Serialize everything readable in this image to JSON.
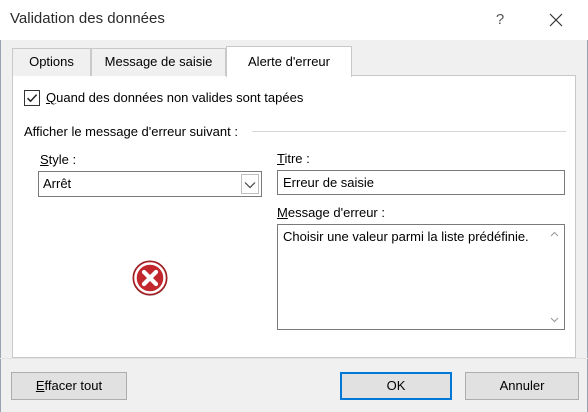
{
  "window": {
    "title": "Validation des données",
    "help_label": "?"
  },
  "tabs": [
    {
      "label": "Options",
      "active": false
    },
    {
      "label": "Message de saisie",
      "active": false
    },
    {
      "label": "Alerte d'erreur",
      "active": true
    }
  ],
  "error_alert": {
    "show_checkbox": {
      "checked": true,
      "label_first": "Q",
      "label_rest": "uand des données non valides sont tapées"
    },
    "section_label": "Afficher le message d'erreur suivant :",
    "style_label": {
      "first": "S",
      "mid": "tyle",
      "end": " :"
    },
    "style_value": "Arrêt",
    "title_label": {
      "first": "T",
      "rest": "itre :"
    },
    "title_value": "Erreur de saisie",
    "message_label": {
      "first": "M",
      "rest": "essage d'erreur :"
    },
    "message_value": "Choisir une valeur parmi la liste prédéfinie.",
    "style_icon": "stop-error-icon"
  },
  "buttons": {
    "clear": {
      "first": "E",
      "rest": "ffacer tout"
    },
    "ok": "OK",
    "cancel": "Annuler"
  },
  "colors": {
    "accent": "#0078d7",
    "error_icon": "#c1272d"
  }
}
